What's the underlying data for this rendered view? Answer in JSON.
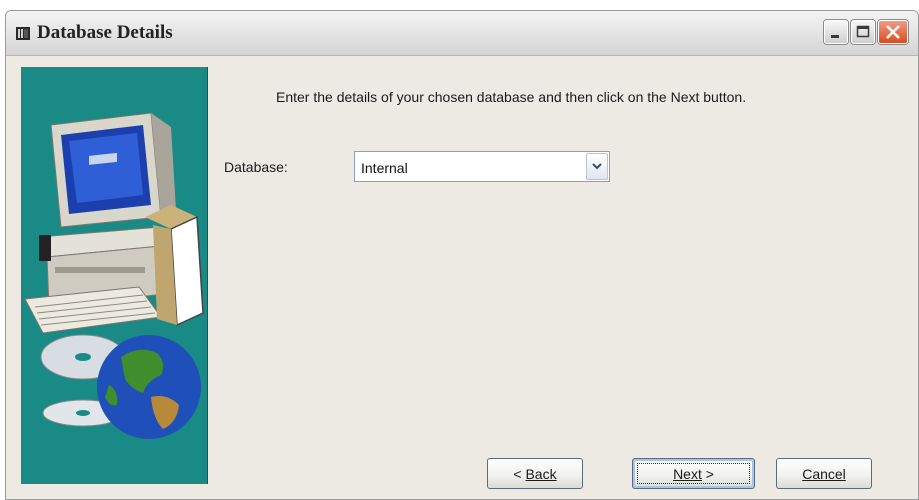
{
  "window": {
    "title": "Database Details",
    "icon": "database-app-icon",
    "controls": [
      "minimize-icon",
      "maximize-icon",
      "close-icon"
    ]
  },
  "side_panel": {
    "illustration": [
      "computer-illustration",
      "globe-illustration",
      "cd-illustration"
    ],
    "background_color": "#198a86"
  },
  "main": {
    "instruction": "Enter the details of your chosen database and then click on the Next button.",
    "database_label": "Database:",
    "database_value": "Internal"
  },
  "buttons": {
    "back_prefix": "< ",
    "back_label": "Back",
    "next_label": "Next",
    "next_suffix": " >",
    "cancel_label": "Cancel"
  },
  "colors": {
    "close_button": "#d84b22",
    "dialog_background": "#eceae3"
  }
}
